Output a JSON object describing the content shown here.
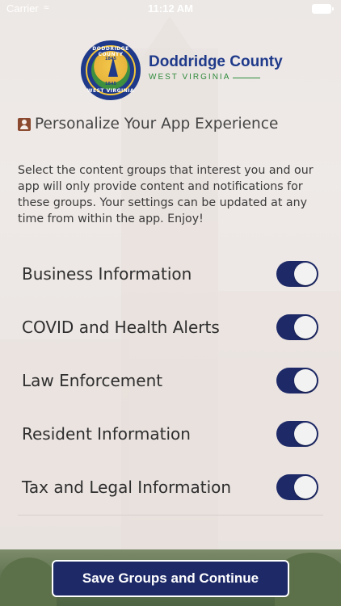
{
  "status_bar": {
    "carrier": "Carrier",
    "time": "11:12 AM"
  },
  "brand": {
    "name": "Doddridge County",
    "state": "WEST VIRGINIA",
    "seal_top": "DODDRIDGE COUNTY",
    "seal_bottom": "WEST VIRGINIA",
    "seal_year_top": "1845",
    "seal_year_bottom": "1845"
  },
  "heading": {
    "icon": "person-badge-icon",
    "title": "Personalize Your App Experience"
  },
  "description": "Select the content groups that interest you and our app will only provide content and notifications for these groups. Your settings can be updated at any time from within the app. Enjoy!",
  "groups": [
    {
      "label": "Business Information",
      "enabled": true
    },
    {
      "label": "COVID and Health Alerts",
      "enabled": true
    },
    {
      "label": "Law Enforcement",
      "enabled": true
    },
    {
      "label": "Resident Information",
      "enabled": true
    },
    {
      "label": "Tax and Legal Information",
      "enabled": true
    }
  ],
  "actions": {
    "save_label": "Save Groups and Continue"
  },
  "colors": {
    "primary": "#1e2a68",
    "brand_blue": "#1f3a8a",
    "brand_green": "#2f8a3a",
    "heading_icon": "#8b4a2f"
  }
}
